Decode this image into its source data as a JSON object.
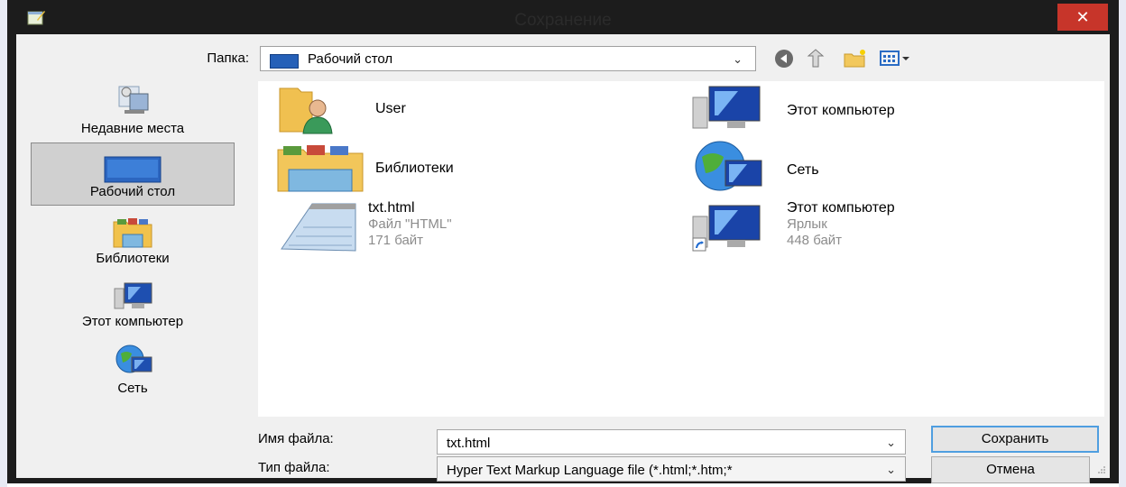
{
  "window": {
    "title": "Сохранение",
    "close_label": "✕"
  },
  "toolbar": {
    "folder_label": "Папка:",
    "folder_value": "Рабочий стол",
    "buttons": [
      "back-icon",
      "up-folder-icon",
      "new-folder-icon",
      "view-menu-icon"
    ]
  },
  "places": [
    {
      "label": "Недавние места",
      "icon": "recent-places-icon",
      "selected": false
    },
    {
      "label": "Рабочий стол",
      "icon": "desktop-icon",
      "selected": true
    },
    {
      "label": "Библиотеки",
      "icon": "libraries-icon",
      "selected": false
    },
    {
      "label": "Этот компьютер",
      "icon": "computer-icon",
      "selected": false
    },
    {
      "label": "Сеть",
      "icon": "network-icon",
      "selected": false
    }
  ],
  "files": [
    {
      "name": "User",
      "icon": "user-folder-icon"
    },
    {
      "name": "Этот компьютер",
      "icon": "computer-icon"
    },
    {
      "name": "Библиотеки",
      "icon": "libraries-icon"
    },
    {
      "name": "Сеть",
      "icon": "network-icon"
    },
    {
      "name": "txt.html",
      "type": "Файл \"HTML\"",
      "size": "171 байт",
      "icon": "notepad-file-icon"
    },
    {
      "name": "Этот компьютер",
      "type": "Ярлык",
      "size": "448 байт",
      "icon": "computer-shortcut-icon"
    }
  ],
  "form": {
    "filename_label": "Имя файла:",
    "filename_value": "txt.html",
    "filetype_label": "Тип файла:",
    "filetype_value": "Hyper Text Markup Language file (*.html;*.htm;*",
    "save_label": "Сохранить",
    "cancel_label": "Отмена"
  },
  "colors": {
    "accent": "#4f9ee0",
    "close": "#c7352a",
    "frame": "#1c1c1c"
  }
}
